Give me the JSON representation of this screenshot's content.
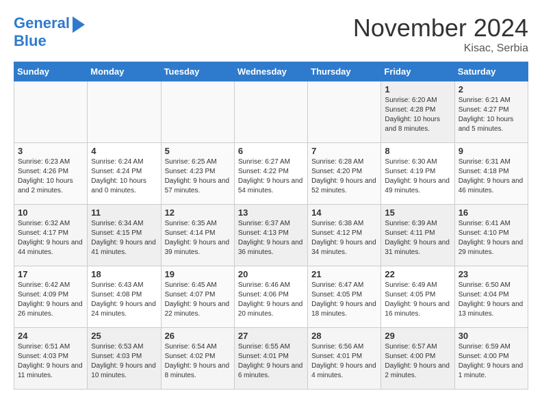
{
  "header": {
    "logo_line1": "General",
    "logo_line2": "Blue",
    "month": "November 2024",
    "location": "Kisac, Serbia"
  },
  "days_of_week": [
    "Sunday",
    "Monday",
    "Tuesday",
    "Wednesday",
    "Thursday",
    "Friday",
    "Saturday"
  ],
  "weeks": [
    [
      {
        "num": "",
        "info": ""
      },
      {
        "num": "",
        "info": ""
      },
      {
        "num": "",
        "info": ""
      },
      {
        "num": "",
        "info": ""
      },
      {
        "num": "",
        "info": ""
      },
      {
        "num": "1",
        "info": "Sunrise: 6:20 AM\nSunset: 4:28 PM\nDaylight: 10 hours and 8 minutes."
      },
      {
        "num": "2",
        "info": "Sunrise: 6:21 AM\nSunset: 4:27 PM\nDaylight: 10 hours and 5 minutes."
      }
    ],
    [
      {
        "num": "3",
        "info": "Sunrise: 6:23 AM\nSunset: 4:26 PM\nDaylight: 10 hours and 2 minutes."
      },
      {
        "num": "4",
        "info": "Sunrise: 6:24 AM\nSunset: 4:24 PM\nDaylight: 10 hours and 0 minutes."
      },
      {
        "num": "5",
        "info": "Sunrise: 6:25 AM\nSunset: 4:23 PM\nDaylight: 9 hours and 57 minutes."
      },
      {
        "num": "6",
        "info": "Sunrise: 6:27 AM\nSunset: 4:22 PM\nDaylight: 9 hours and 54 minutes."
      },
      {
        "num": "7",
        "info": "Sunrise: 6:28 AM\nSunset: 4:20 PM\nDaylight: 9 hours and 52 minutes."
      },
      {
        "num": "8",
        "info": "Sunrise: 6:30 AM\nSunset: 4:19 PM\nDaylight: 9 hours and 49 minutes."
      },
      {
        "num": "9",
        "info": "Sunrise: 6:31 AM\nSunset: 4:18 PM\nDaylight: 9 hours and 46 minutes."
      }
    ],
    [
      {
        "num": "10",
        "info": "Sunrise: 6:32 AM\nSunset: 4:17 PM\nDaylight: 9 hours and 44 minutes."
      },
      {
        "num": "11",
        "info": "Sunrise: 6:34 AM\nSunset: 4:15 PM\nDaylight: 9 hours and 41 minutes."
      },
      {
        "num": "12",
        "info": "Sunrise: 6:35 AM\nSunset: 4:14 PM\nDaylight: 9 hours and 39 minutes."
      },
      {
        "num": "13",
        "info": "Sunrise: 6:37 AM\nSunset: 4:13 PM\nDaylight: 9 hours and 36 minutes."
      },
      {
        "num": "14",
        "info": "Sunrise: 6:38 AM\nSunset: 4:12 PM\nDaylight: 9 hours and 34 minutes."
      },
      {
        "num": "15",
        "info": "Sunrise: 6:39 AM\nSunset: 4:11 PM\nDaylight: 9 hours and 31 minutes."
      },
      {
        "num": "16",
        "info": "Sunrise: 6:41 AM\nSunset: 4:10 PM\nDaylight: 9 hours and 29 minutes."
      }
    ],
    [
      {
        "num": "17",
        "info": "Sunrise: 6:42 AM\nSunset: 4:09 PM\nDaylight: 9 hours and 26 minutes."
      },
      {
        "num": "18",
        "info": "Sunrise: 6:43 AM\nSunset: 4:08 PM\nDaylight: 9 hours and 24 minutes."
      },
      {
        "num": "19",
        "info": "Sunrise: 6:45 AM\nSunset: 4:07 PM\nDaylight: 9 hours and 22 minutes."
      },
      {
        "num": "20",
        "info": "Sunrise: 6:46 AM\nSunset: 4:06 PM\nDaylight: 9 hours and 20 minutes."
      },
      {
        "num": "21",
        "info": "Sunrise: 6:47 AM\nSunset: 4:05 PM\nDaylight: 9 hours and 18 minutes."
      },
      {
        "num": "22",
        "info": "Sunrise: 6:49 AM\nSunset: 4:05 PM\nDaylight: 9 hours and 16 minutes."
      },
      {
        "num": "23",
        "info": "Sunrise: 6:50 AM\nSunset: 4:04 PM\nDaylight: 9 hours and 13 minutes."
      }
    ],
    [
      {
        "num": "24",
        "info": "Sunrise: 6:51 AM\nSunset: 4:03 PM\nDaylight: 9 hours and 11 minutes."
      },
      {
        "num": "25",
        "info": "Sunrise: 6:53 AM\nSunset: 4:03 PM\nDaylight: 9 hours and 10 minutes."
      },
      {
        "num": "26",
        "info": "Sunrise: 6:54 AM\nSunset: 4:02 PM\nDaylight: 9 hours and 8 minutes."
      },
      {
        "num": "27",
        "info": "Sunrise: 6:55 AM\nSunset: 4:01 PM\nDaylight: 9 hours and 6 minutes."
      },
      {
        "num": "28",
        "info": "Sunrise: 6:56 AM\nSunset: 4:01 PM\nDaylight: 9 hours and 4 minutes."
      },
      {
        "num": "29",
        "info": "Sunrise: 6:57 AM\nSunset: 4:00 PM\nDaylight: 9 hours and 2 minutes."
      },
      {
        "num": "30",
        "info": "Sunrise: 6:59 AM\nSunset: 4:00 PM\nDaylight: 9 hours and 1 minute."
      }
    ]
  ]
}
